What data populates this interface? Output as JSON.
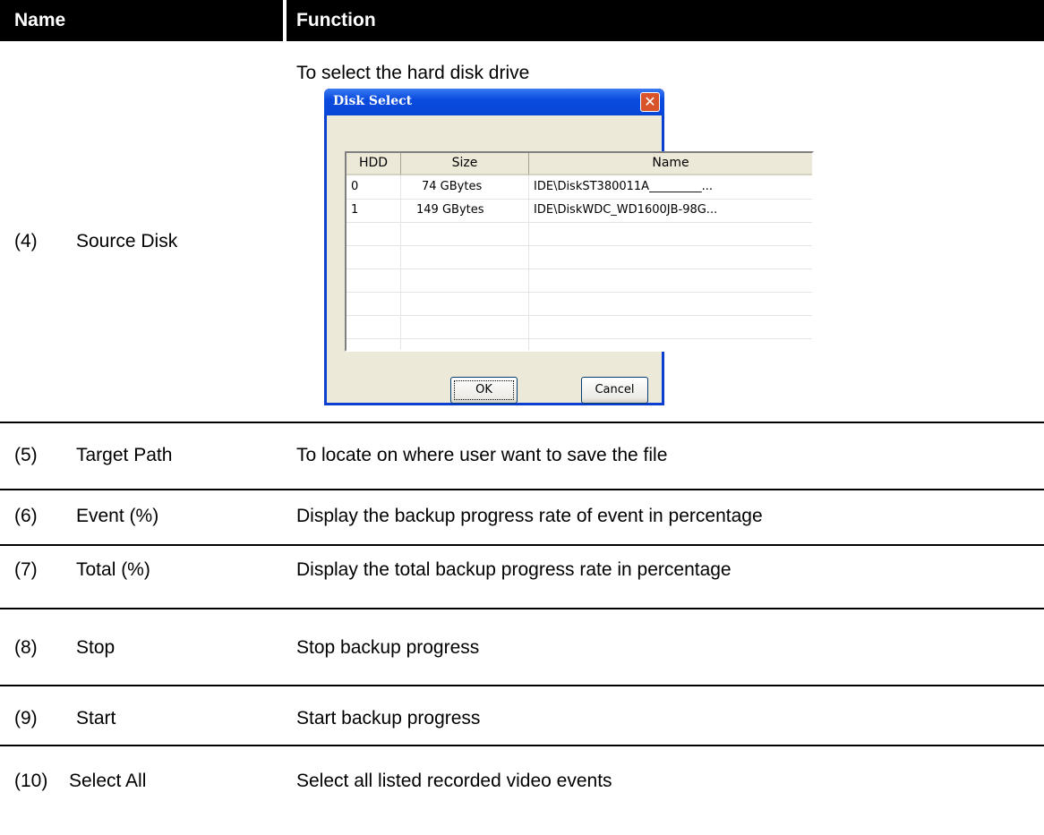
{
  "header": {
    "name_label": "Name",
    "function_label": "Function"
  },
  "source_disk": {
    "num": "(4)",
    "name": "Source Disk",
    "function": "To select the hard disk drive"
  },
  "dialog": {
    "title": "Disk Select",
    "close_glyph": "✕",
    "columns": [
      "HDD",
      "Size",
      "Name"
    ],
    "rows": [
      {
        "hdd": "0",
        "size": "74 GBytes",
        "name": "IDE\\DiskST380011A_________..."
      },
      {
        "hdd": "1",
        "size": "149 GBytes",
        "name": "IDE\\DiskWDC_WD1600JB-98G..."
      }
    ],
    "ok_label": "OK",
    "cancel_label": "Cancel"
  },
  "rows": [
    {
      "num": "(5)",
      "name": "Target Path",
      "function": "To locate on where user want to save the file"
    },
    {
      "num": "(6)",
      "name": "Event (%)",
      "function": "Display the backup progress rate of event in percentage"
    },
    {
      "num": "(7)",
      "name": "Total (%)",
      "function": "Display the total backup progress rate in percentage"
    },
    {
      "num": "(8)",
      "name": "Stop",
      "function": "Stop backup progress"
    },
    {
      "num": "(9)",
      "name": "Start",
      "function": "Start backup progress"
    },
    {
      "num": "(10)",
      "name": "Select All",
      "function": "Select all listed recorded video events"
    }
  ]
}
